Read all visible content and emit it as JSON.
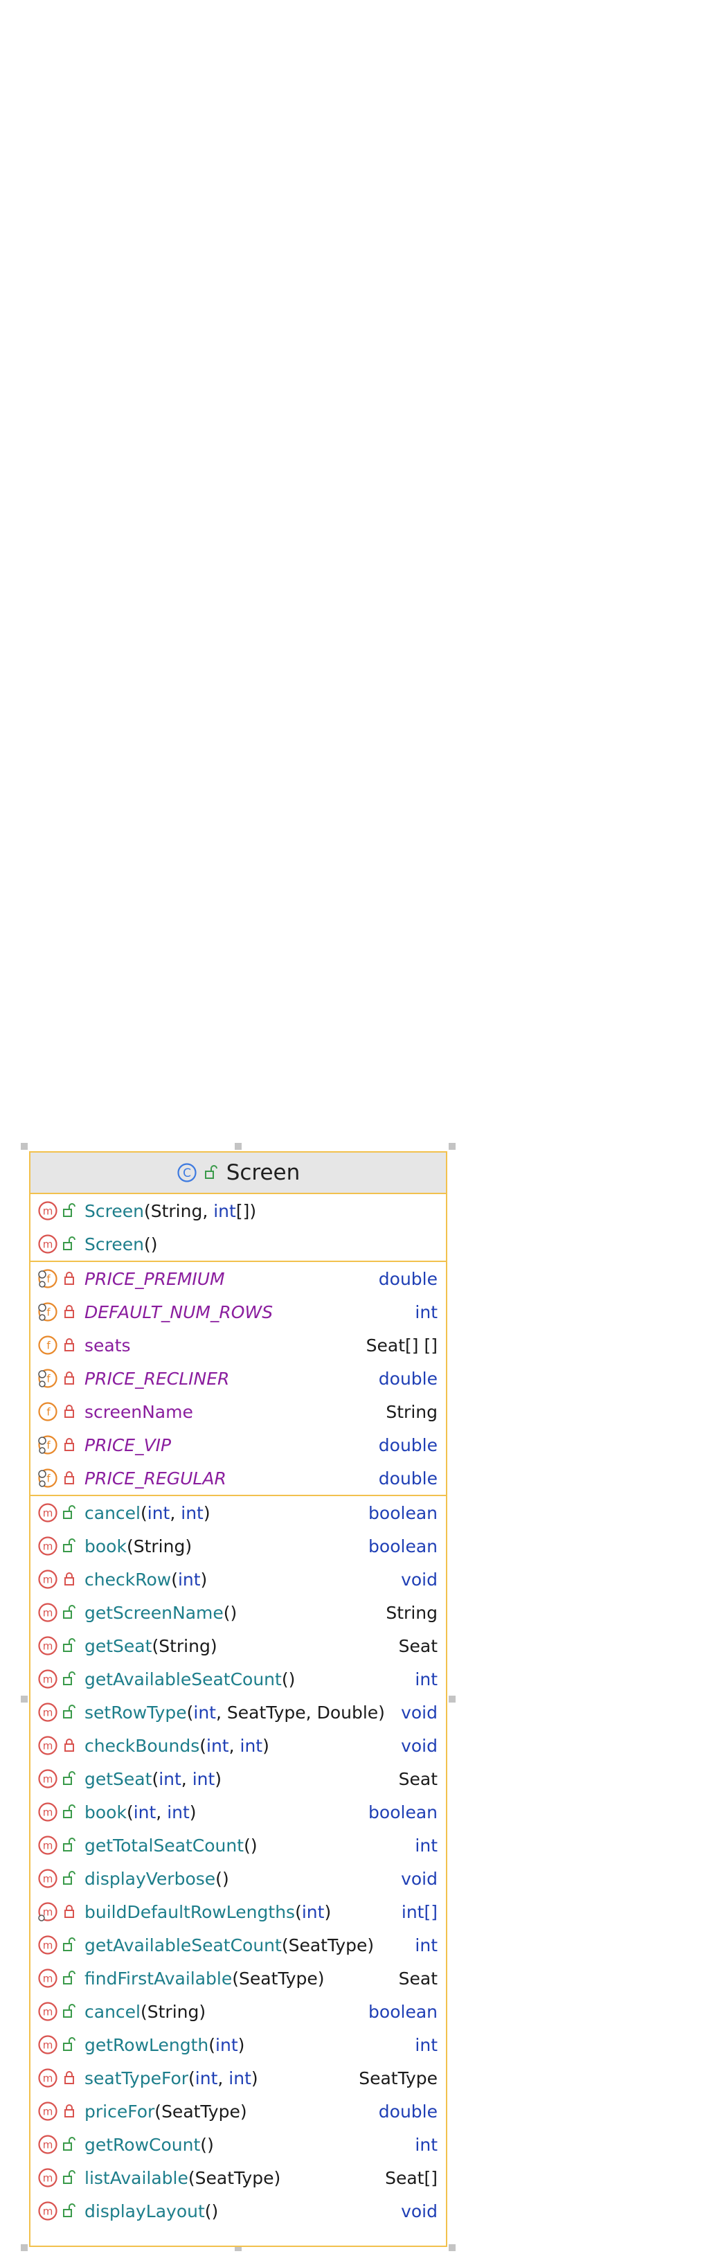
{
  "class": {
    "name": "Screen",
    "constructors": [
      {
        "name": "Screen",
        "params": [
          [
            "String",
            "cls"
          ],
          [
            ", ",
            "p"
          ],
          [
            "int",
            "kw"
          ],
          [
            "[]",
            "cls"
          ]
        ],
        "vis": "public"
      },
      {
        "name": "Screen",
        "params": [],
        "vis": "public"
      }
    ],
    "fields": [
      {
        "name": "PRICE_PREMIUM",
        "type": "double",
        "type_kind": "kw",
        "static": true,
        "vis": "private"
      },
      {
        "name": "DEFAULT_NUM_ROWS",
        "type": "int",
        "type_kind": "kw",
        "static": true,
        "vis": "private"
      },
      {
        "name": "seats",
        "type": "Seat[] []",
        "type_kind": "cls",
        "static": false,
        "vis": "private"
      },
      {
        "name": "PRICE_RECLINER",
        "type": "double",
        "type_kind": "kw",
        "static": true,
        "vis": "private"
      },
      {
        "name": "screenName",
        "type": "String",
        "type_kind": "cls",
        "static": false,
        "vis": "private"
      },
      {
        "name": "PRICE_VIP",
        "type": "double",
        "type_kind": "kw",
        "static": true,
        "vis": "private"
      },
      {
        "name": "PRICE_REGULAR",
        "type": "double",
        "type_kind": "kw",
        "static": true,
        "vis": "private"
      }
    ],
    "methods": [
      {
        "name": "cancel",
        "params": [
          [
            "int",
            "kw"
          ],
          [
            ", ",
            "p"
          ],
          [
            "int",
            "kw"
          ]
        ],
        "type": "boolean",
        "type_kind": "kw",
        "vis": "public"
      },
      {
        "name": "book",
        "params": [
          [
            "String",
            "cls"
          ]
        ],
        "type": "boolean",
        "type_kind": "kw",
        "vis": "public"
      },
      {
        "name": "checkRow",
        "params": [
          [
            "int",
            "kw"
          ]
        ],
        "type": "void",
        "type_kind": "kw",
        "vis": "private"
      },
      {
        "name": "getScreenName",
        "params": [],
        "type": "String",
        "type_kind": "cls",
        "vis": "public"
      },
      {
        "name": "getSeat",
        "params": [
          [
            "String",
            "cls"
          ]
        ],
        "type": "Seat",
        "type_kind": "cls",
        "vis": "public"
      },
      {
        "name": "getAvailableSeatCount",
        "params": [],
        "type": "int",
        "type_kind": "kw",
        "vis": "public"
      },
      {
        "name": "setRowType",
        "params": [
          [
            "int",
            "kw"
          ],
          [
            ", SeatType, Double",
            "cls"
          ]
        ],
        "type": "void",
        "type_kind": "kw",
        "vis": "public"
      },
      {
        "name": "checkBounds",
        "params": [
          [
            "int",
            "kw"
          ],
          [
            ", ",
            "p"
          ],
          [
            "int",
            "kw"
          ]
        ],
        "type": "void",
        "type_kind": "kw",
        "vis": "private"
      },
      {
        "name": "getSeat",
        "params": [
          [
            "int",
            "kw"
          ],
          [
            ", ",
            "p"
          ],
          [
            "int",
            "kw"
          ]
        ],
        "type": "Seat",
        "type_kind": "cls",
        "vis": "public"
      },
      {
        "name": "book",
        "params": [
          [
            "int",
            "kw"
          ],
          [
            ", ",
            "p"
          ],
          [
            "int",
            "kw"
          ]
        ],
        "type": "boolean",
        "type_kind": "kw",
        "vis": "public"
      },
      {
        "name": "getTotalSeatCount",
        "params": [],
        "type": "int",
        "type_kind": "kw",
        "vis": "public"
      },
      {
        "name": "displayVerbose",
        "params": [],
        "type": "void",
        "type_kind": "kw",
        "vis": "public"
      },
      {
        "name": "buildDefaultRowLengths",
        "params": [
          [
            "int",
            "kw"
          ]
        ],
        "type": "int[]",
        "type_kind": "kw",
        "static": true,
        "vis": "private"
      },
      {
        "name": "getAvailableSeatCount",
        "params": [
          [
            "SeatType",
            "cls"
          ]
        ],
        "type": "int",
        "type_kind": "kw",
        "vis": "public"
      },
      {
        "name": "findFirstAvailable",
        "params": [
          [
            "SeatType",
            "cls"
          ]
        ],
        "type": "Seat",
        "type_kind": "cls",
        "vis": "public"
      },
      {
        "name": "cancel",
        "params": [
          [
            "String",
            "cls"
          ]
        ],
        "type": "boolean",
        "type_kind": "kw",
        "vis": "public"
      },
      {
        "name": "getRowLength",
        "params": [
          [
            "int",
            "kw"
          ]
        ],
        "type": "int",
        "type_kind": "kw",
        "vis": "public"
      },
      {
        "name": "seatTypeFor",
        "params": [
          [
            "int",
            "kw"
          ],
          [
            ", ",
            "p"
          ],
          [
            "int",
            "kw"
          ]
        ],
        "type": "SeatType",
        "type_kind": "cls",
        "vis": "private"
      },
      {
        "name": "priceFor",
        "params": [
          [
            "SeatType",
            "cls"
          ]
        ],
        "type": "double",
        "type_kind": "kw",
        "vis": "private"
      },
      {
        "name": "getRowCount",
        "params": [],
        "type": "int",
        "type_kind": "kw",
        "vis": "public"
      },
      {
        "name": "listAvailable",
        "params": [
          [
            "SeatType",
            "cls"
          ]
        ],
        "type": "Seat[]",
        "type_kind": "cls",
        "vis": "public"
      },
      {
        "name": "displayLayout",
        "params": [],
        "type": "void",
        "type_kind": "kw",
        "vis": "public"
      }
    ]
  },
  "colors": {
    "border": "#f2c14e",
    "header_bg": "#e6e6e6",
    "method_icon": "#d9534f",
    "field_icon": "#e8892b",
    "class_icon": "#3d7ae0",
    "public_icon": "#3a9a4a",
    "private_icon": "#d9534f"
  },
  "icons": {
    "class": "class-c-icon",
    "method": "method-m-icon",
    "field": "field-f-icon",
    "public": "unlocked-icon",
    "private": "locked-icon"
  }
}
